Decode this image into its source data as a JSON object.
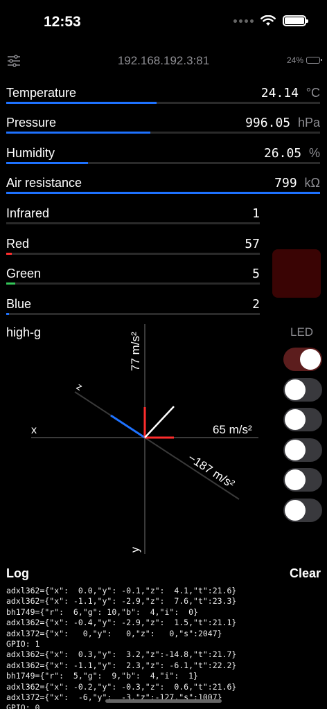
{
  "status": {
    "time": "12:53"
  },
  "header": {
    "host": "192.168.192.3:81",
    "battery": "24%"
  },
  "sensors": [
    {
      "label": "Temperature",
      "value": "24.14",
      "unit": "°C",
      "level": 0.48
    },
    {
      "label": "Pressure",
      "value": "996.05",
      "unit": "hPa",
      "level": 0.46
    },
    {
      "label": "Humidity",
      "value": "26.05",
      "unit": "%",
      "level": 0.26
    },
    {
      "label": "Air resistance",
      "value": "799",
      "unit": "kΩ",
      "level": 1.0
    }
  ],
  "light": [
    {
      "label": "Infrared",
      "value": "1",
      "color": "#1e72ff",
      "level": 0.0
    },
    {
      "label": "Red",
      "value": "57",
      "color": "#ff2d2d",
      "level": 0.022
    },
    {
      "label": "Green",
      "value": "5",
      "color": "#34c759",
      "level": 0.035
    },
    {
      "label": "Blue",
      "value": "2",
      "color": "#1e72ff",
      "level": 0.012
    }
  ],
  "swatch_color": "#3a0404",
  "accel": {
    "title": "high-g",
    "y_label": "77 m/s²",
    "x_label": "65 m/s²",
    "z_label": "−187 m/s²",
    "axis_x": "x",
    "axis_y": "y",
    "axis_z": "z"
  },
  "led": {
    "label": "LED",
    "states": [
      true,
      false,
      false,
      false,
      false,
      false
    ]
  },
  "log": {
    "title": "Log",
    "clear": "Clear",
    "lines": [
      "adxl362={\"x\":  0.0,\"y\": -0.1,\"z\":  4.1,\"t\":21.6}",
      "adxl362={\"x\": -1.1,\"y\": -2.9,\"z\":  7.6,\"t\":23.3}",
      "bh1749={\"r\":  6,\"g\": 10,\"b\":  4,\"i\":  0}",
      "adxl362={\"x\": -0.4,\"y\": -2.9,\"z\":  1.5,\"t\":21.1}",
      "adxl372={\"x\":   0,\"y\":   0,\"z\":   0,\"s\":2047}",
      "GPIO: 1",
      "adxl362={\"x\":  0.3,\"y\":  3.2,\"z\":-14.8,\"t\":21.7}",
      "adxl362={\"x\": -1.1,\"y\":  2.3,\"z\": -6.1,\"t\":22.2}",
      "bh1749={\"r\":  5,\"g\":  9,\"b\":  4,\"i\":  1}",
      "adxl362={\"x\": -0.2,\"y\": -0.3,\"z\":  0.6,\"t\":21.6}",
      "adxl372={\"x\":  -6,\"y\":  -3,\"z\":-127,\"s\":1007}",
      "GPIO: 0"
    ]
  }
}
